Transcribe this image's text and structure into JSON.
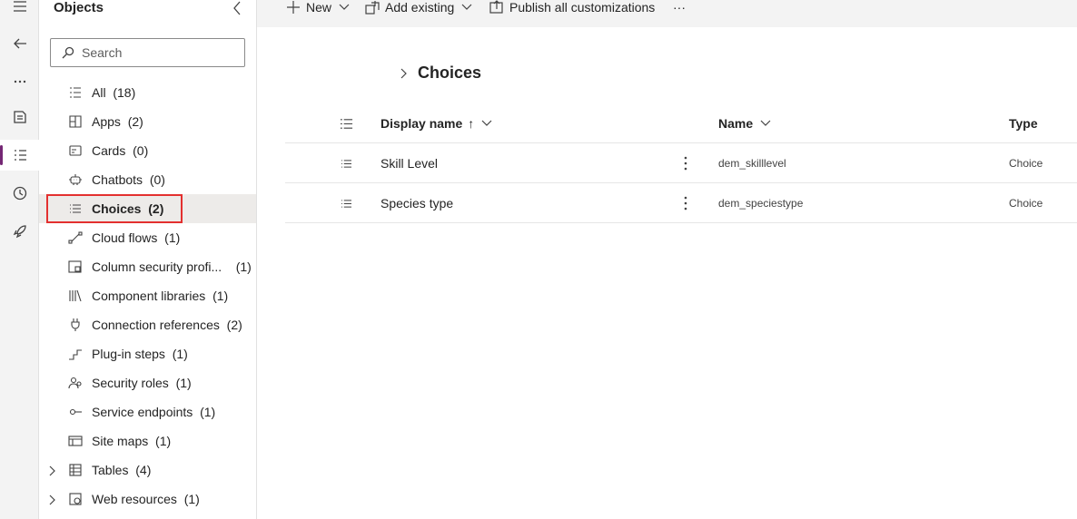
{
  "rail": {
    "items": [
      "menu-icon",
      "back-icon",
      "more-icon",
      "book-icon",
      "objects-icon",
      "history-icon",
      "rocket-icon"
    ]
  },
  "objects": {
    "title": "Objects",
    "search_placeholder": "Search",
    "items": [
      {
        "label": "All",
        "count": "(18)",
        "icon": "list-icon"
      },
      {
        "label": "Apps",
        "count": "(2)",
        "icon": "apps-icon"
      },
      {
        "label": "Cards",
        "count": "(0)",
        "icon": "card-icon"
      },
      {
        "label": "Chatbots",
        "count": "(0)",
        "icon": "bot-icon"
      },
      {
        "label": "Choices",
        "count": "(2)",
        "icon": "choices-icon"
      },
      {
        "label": "Cloud flows",
        "count": "(1)",
        "icon": "flow-icon"
      },
      {
        "label": "Column security profi...",
        "count": "(1)",
        "icon": "security-profile-icon"
      },
      {
        "label": "Component libraries",
        "count": "(1)",
        "icon": "library-icon"
      },
      {
        "label": "Connection references",
        "count": "(2)",
        "icon": "plug-icon"
      },
      {
        "label": "Plug-in steps",
        "count": "(1)",
        "icon": "steps-icon"
      },
      {
        "label": "Security roles",
        "count": "(1)",
        "icon": "people-icon"
      },
      {
        "label": "Service endpoints",
        "count": "(1)",
        "icon": "endpoint-icon"
      },
      {
        "label": "Site maps",
        "count": "(1)",
        "icon": "sitemap-icon"
      },
      {
        "label": "Tables",
        "count": "(4)",
        "icon": "table-icon"
      },
      {
        "label": "Web resources",
        "count": "(1)",
        "icon": "globe-icon"
      }
    ]
  },
  "toolbar": {
    "new_label": "New",
    "add_existing_label": "Add existing",
    "publish_label": "Publish all customizations",
    "overflow": "···"
  },
  "main": {
    "breadcrumb": "Choices",
    "columns": {
      "display_name": "Display name",
      "sort_arrow": "↑",
      "name": "Name",
      "type": "Type"
    },
    "rows": [
      {
        "display_name": "Skill Level",
        "name": "dem_skilllevel",
        "type": "Choice"
      },
      {
        "display_name": "Species type",
        "name": "dem_speciestype",
        "type": "Choice"
      }
    ]
  }
}
